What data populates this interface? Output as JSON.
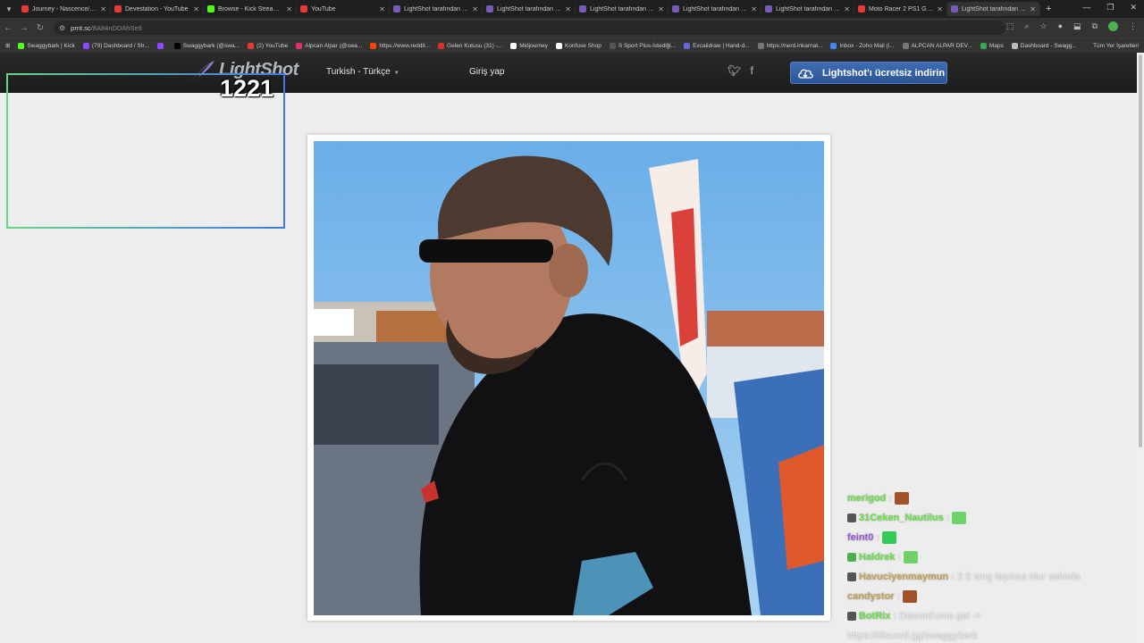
{
  "browser": {
    "tabs": [
      {
        "label": "Journey - Nascence/Apoc",
        "color": "#e53935"
      },
      {
        "label": "Devestation - YouTube",
        "color": "#e53935"
      },
      {
        "label": "Browse - Kick Streaming",
        "color": "#53fc18"
      },
      {
        "label": "YouTube",
        "color": "#e53935"
      },
      {
        "label": "LightShot tarafından Ekra",
        "color": "#7a5ab8"
      },
      {
        "label": "LightShot tarafından Ekra",
        "color": "#7a5ab8"
      },
      {
        "label": "LightShot tarafından Ekra",
        "color": "#7a5ab8"
      },
      {
        "label": "LightShot tarafından Ekra",
        "color": "#7a5ab8"
      },
      {
        "label": "LightShot tarafından Ekra",
        "color": "#7a5ab8"
      },
      {
        "label": "Moto Racer 2 PS1 Gamep",
        "color": "#e53935"
      },
      {
        "label": "LightShot tarafından Ekra",
        "color": "#7a5ab8"
      }
    ],
    "url_host": "prnt.sc",
    "url_path": "/8A84nDDAhSe9",
    "bookmarks": [
      {
        "label": "Swaggybark | Kick",
        "color": "#53fc18"
      },
      {
        "label": "(79) Dashboard / Str...",
        "color": "#9146ff"
      },
      {
        "label": "",
        "color": "#9146ff"
      },
      {
        "label": "Swaggybark (@swa...",
        "color": "#000000"
      },
      {
        "label": "(2) YouTube",
        "color": "#e53935"
      },
      {
        "label": "Alpcan Alpar (@swa...",
        "color": "#e1306c"
      },
      {
        "label": "https://www.reddit...",
        "color": "#ff4500"
      },
      {
        "label": "Gelen Kutusu (31) -...",
        "color": "#d93025"
      },
      {
        "label": "Midjourney",
        "color": "#ffffff"
      },
      {
        "label": "Konfuse Shop",
        "color": "#ffffff"
      },
      {
        "label": "S Sport Plus-İstediği...",
        "color": "#555555"
      },
      {
        "label": "Excalidraw | Hand-d...",
        "color": "#6965db"
      },
      {
        "label": "https://nerd.inkarnat...",
        "color": "#777777"
      },
      {
        "label": "Inbox - Zoho Mail (i...",
        "color": "#4285f4"
      },
      {
        "label": "ALPCAN ALPAR DEV...",
        "color": "#777777"
      },
      {
        "label": "Maps",
        "color": "#34a853"
      },
      {
        "label": "Dashboard - Swagg...",
        "color": "#bbbbbb"
      }
    ],
    "all_bookmarks": "Tüm Yer İşaretleri"
  },
  "header": {
    "logo": "LightShot",
    "language": "Turkish - Türkçe",
    "login": "Giriş yap",
    "download": "Lightshot'ı ücretsiz indirin"
  },
  "overlay": {
    "counter": "1221"
  },
  "chat": [
    {
      "user": "merigod",
      "color": "green",
      "msg": ""
    },
    {
      "user": "31Ceken_Nautilus",
      "color": "green",
      "msg": ""
    },
    {
      "user": "feint0",
      "color": "purple",
      "msg": ""
    },
    {
      "user": "Haldrek",
      "color": "green",
      "msg": ""
    },
    {
      "user": "Havuciyenmaymun",
      "color": "tan",
      "msg": "3 5 smg taşınsa olur aslında"
    },
    {
      "user": "candystor",
      "color": "tan",
      "msg": ""
    },
    {
      "user": "BotRix",
      "color": "green",
      "msg": "Discord'uma gel ->"
    }
  ],
  "chat_cont": "https://discord.gg/swaggybark"
}
